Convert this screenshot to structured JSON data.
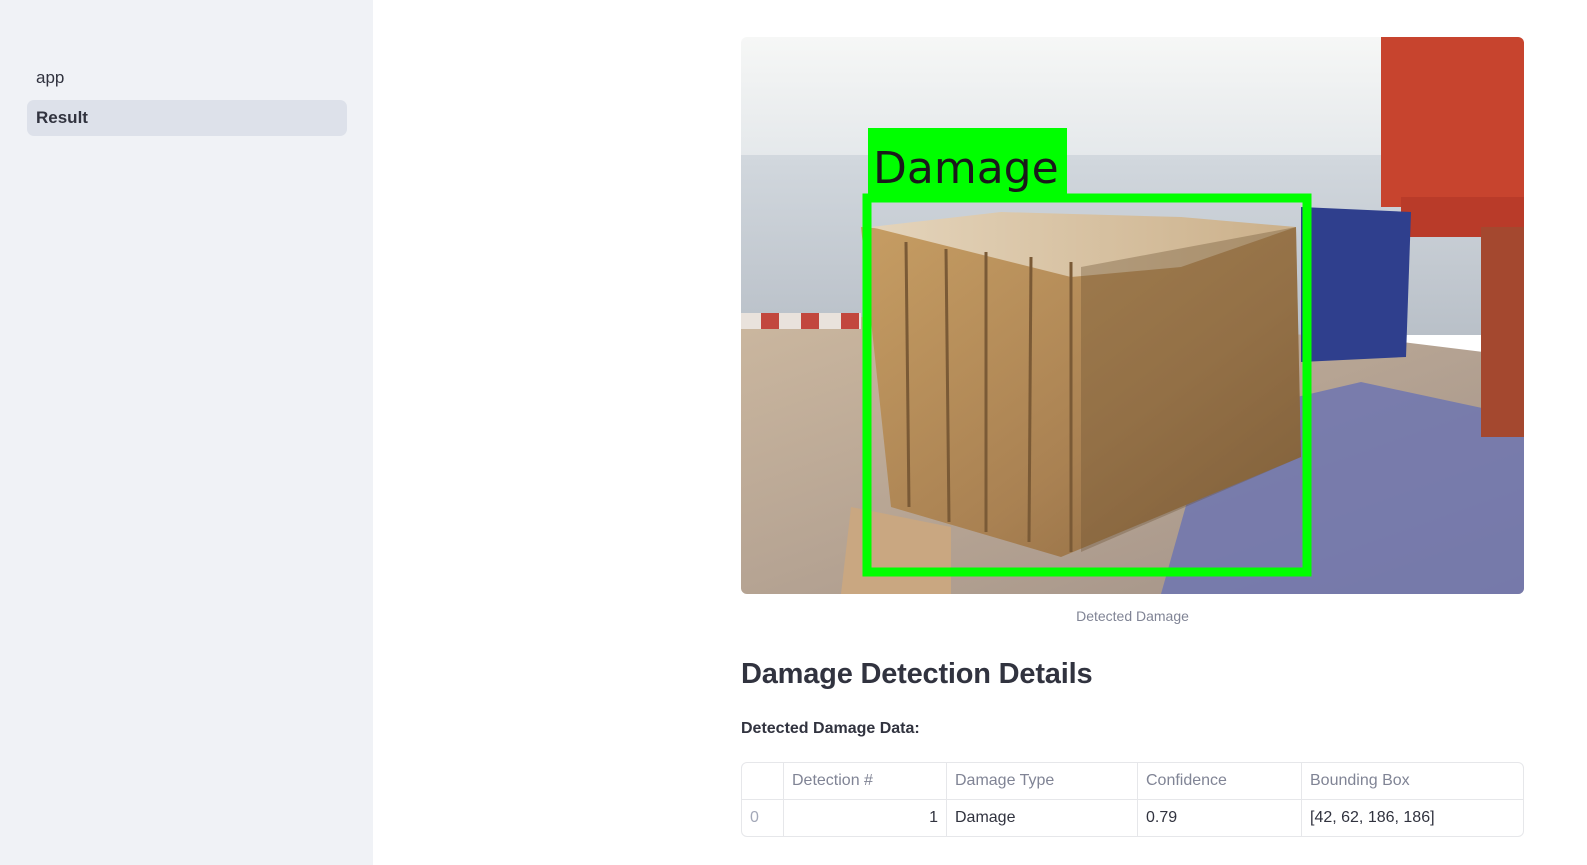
{
  "sidebar": {
    "items": [
      {
        "label": "app",
        "active": false
      },
      {
        "label": "Result",
        "active": true
      }
    ]
  },
  "image": {
    "overlay_label": "Damage",
    "caption": "Detected Damage",
    "box_color": "#00ff00"
  },
  "section_title": "Damage Detection Details",
  "subheading": "Detected Damage Data:",
  "table": {
    "columns": [
      "",
      "Detection #",
      "Damage Type",
      "Confidence",
      "Bounding Box"
    ],
    "rows": [
      {
        "index": "0",
        "detection": "1",
        "type": "Damage",
        "confidence": "0.79",
        "bbox": "[42, 62, 186, 186]"
      }
    ]
  }
}
